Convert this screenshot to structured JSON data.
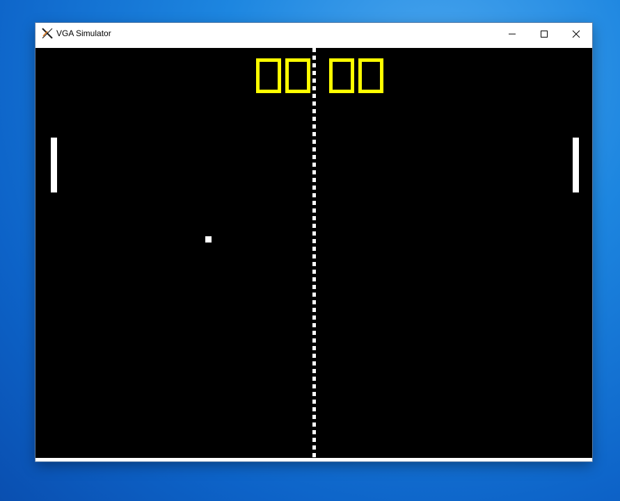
{
  "window": {
    "title": "VGA Simulator",
    "app_icon": "x-logo-icon",
    "controls": {
      "minimize_icon": "minimize-icon",
      "maximize_icon": "maximize-icon",
      "close_icon": "close-icon"
    }
  },
  "game": {
    "left_score": "00",
    "right_score": "00",
    "colors": {
      "background": "#000000",
      "foreground": "#ffffff",
      "score": "#ffff00"
    }
  }
}
